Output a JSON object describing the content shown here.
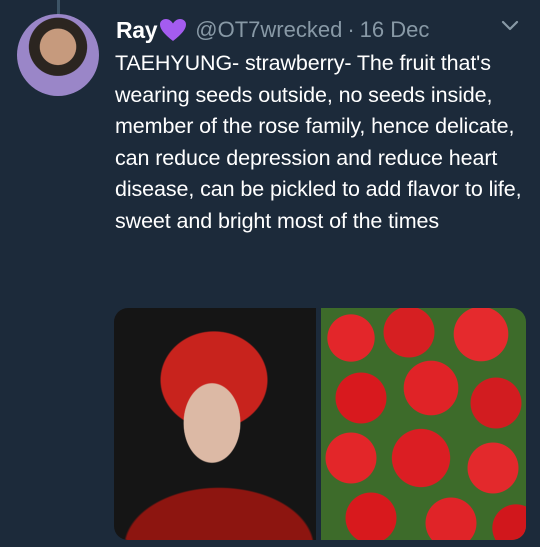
{
  "tweet": {
    "author_name": "Ray",
    "author_emoji": "purple-heart",
    "handle": "@OT7wrecked",
    "separator": "·",
    "date": "16 Dec",
    "text": "TAEHYUNG- strawberry- The fruit that's wearing seeds outside, no seeds inside, member of the rose family, hence delicate, can reduce depression and reduce heart disease, can be pickled to add flavor to life, sweet and bright most of the times",
    "media": [
      "person-photo",
      "strawberries-photo"
    ]
  },
  "colors": {
    "background": "#1c2a3a",
    "secondary_text": "#8899a6",
    "heart": "#a45cf0"
  }
}
